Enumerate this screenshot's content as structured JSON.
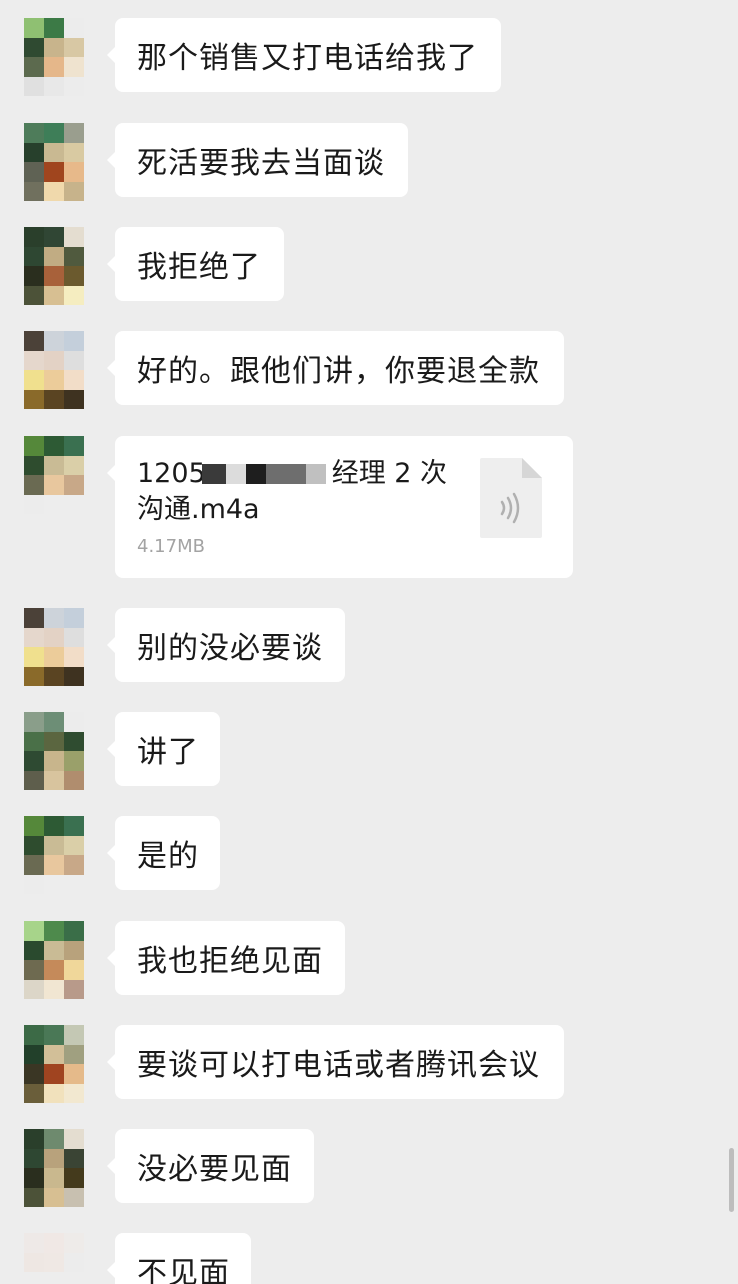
{
  "messages": [
    {
      "text": "那个销售又打电话给我了"
    },
    {
      "text": "死活要我去当面谈"
    },
    {
      "text": "我拒绝了"
    },
    {
      "text": "好的。跟他们讲，你要退全款"
    },
    {
      "type": "file",
      "name_line1_start": "1205",
      "name_line1_end": "经理 2 次",
      "name_line2": "沟通.m4a",
      "size": "4.17MB",
      "icon": "audio-file-icon"
    },
    {
      "text": "别的没必要谈"
    },
    {
      "text": "讲了"
    },
    {
      "text": "是的"
    },
    {
      "text": "我也拒绝见面"
    },
    {
      "text": "要谈可以打电话或者腾讯会议"
    },
    {
      "text": "没必要见面"
    },
    {
      "text": "不见面"
    }
  ],
  "colors": {
    "background": "#ededed",
    "bubble": "#ffffff",
    "text": "#1a1a1a",
    "meta_text": "#a3a3a3"
  }
}
